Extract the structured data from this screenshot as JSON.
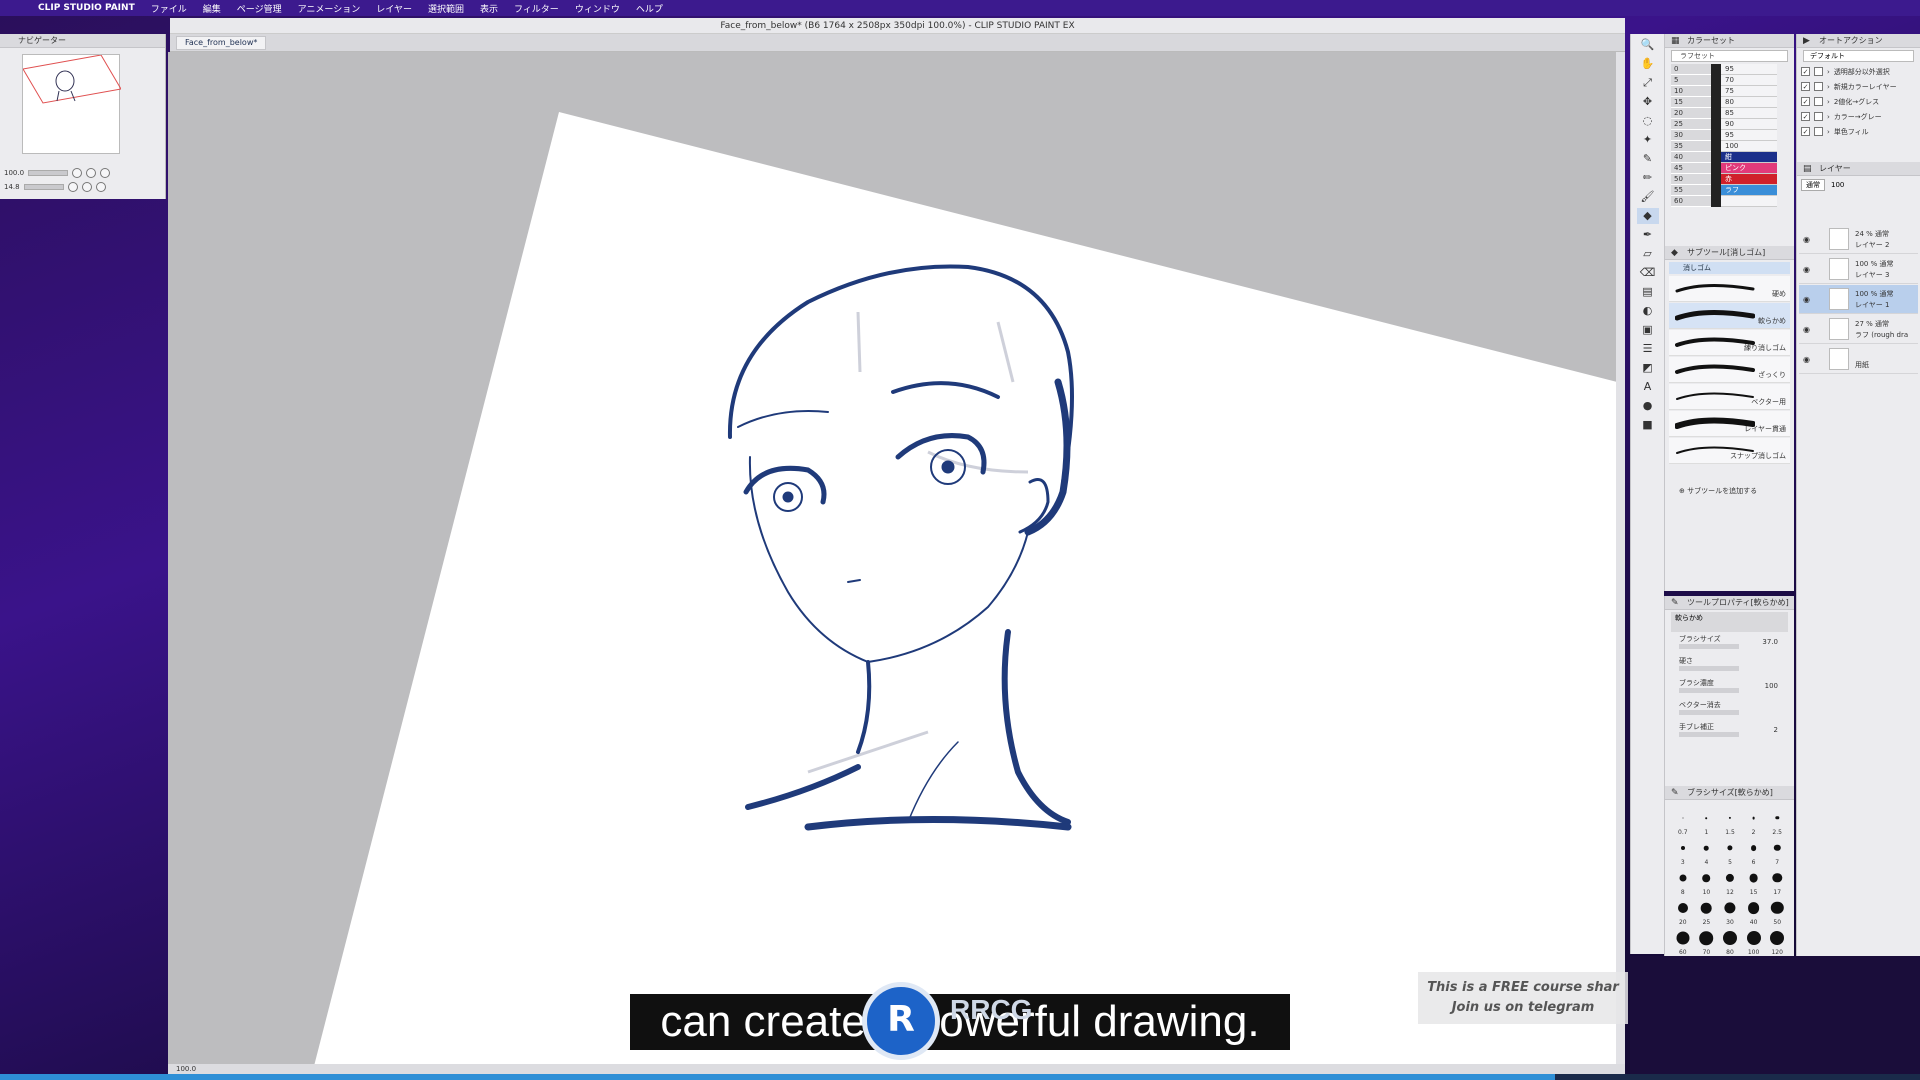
{
  "menubar": {
    "app_name": "CLIP STUDIO PAINT",
    "items": [
      "ファイル",
      "編集",
      "ページ管理",
      "アニメーション",
      "レイヤー",
      "選択範囲",
      "表示",
      "フィルター",
      "ウィンドウ",
      "ヘルプ"
    ]
  },
  "window": {
    "title": "Face_from_below* (B6 1764 x 2508px 350dpi 100.0%)  - CLIP STUDIO PAINT EX",
    "tab_label": "Face_from_below*"
  },
  "navigator": {
    "title": "ナビゲーター",
    "zoom_value": "100.0",
    "rotation_value": "14.8"
  },
  "canvas": {
    "status_zoom": "100.0",
    "progress": 0.81
  },
  "subtitle": {
    "text": "can create a powerful drawing."
  },
  "watermark": {
    "logo_text": "R",
    "brand": "RRCG"
  },
  "promo": {
    "line1": "This is a FREE course shar",
    "line2": "Join us on telegram"
  },
  "tools": [
    "🔍",
    "✋",
    "⤢",
    "✥",
    "◌",
    "✦",
    "✎",
    "✏",
    "🖌",
    "◆",
    "✒",
    "▱",
    "⌫",
    "▤",
    "◐",
    "▣",
    "☰",
    "◩",
    "A",
    "●",
    "■"
  ],
  "color_set": {
    "title": "カラーセット",
    "preset": "ラフセット",
    "rows": [
      {
        "a": "0",
        "c": "95"
      },
      {
        "a": "5",
        "c": "70"
      },
      {
        "a": "10",
        "c": "75"
      },
      {
        "a": "15",
        "c": "80"
      },
      {
        "a": "20",
        "c": "85"
      },
      {
        "a": "25",
        "c": "90"
      },
      {
        "a": "30",
        "c": "95"
      },
      {
        "a": "35",
        "c": "100"
      },
      {
        "a": "40",
        "c": "紺"
      },
      {
        "a": "45",
        "c": "ピンク"
      },
      {
        "a": "50",
        "c": "赤"
      },
      {
        "a": "55",
        "c": "ラフ"
      },
      {
        "a": "60",
        "c": ""
      }
    ],
    "accent_colors": [
      "#1b2f8a",
      "#e23a7a",
      "#d0202a",
      "#3a8ed8"
    ]
  },
  "subtool": {
    "title": "サブツール[消しゴム]",
    "group": "消しゴム",
    "brushes": [
      "硬め",
      "軟らかめ",
      "練り消しゴム",
      "ざっくり",
      "ベクター用",
      "レイヤー貫通",
      "スナップ消しゴム"
    ],
    "add_label": "サブツールを追加する"
  },
  "tool_property": {
    "title": "ツールプロパティ[軟らかめ]",
    "name": "軟らかめ",
    "rows": [
      {
        "label": "ブラシサイズ",
        "value": "37.0"
      },
      {
        "label": "硬さ",
        "value": ""
      },
      {
        "label": "ブラシ濃度",
        "value": "100"
      },
      {
        "label": "ベクター消去",
        "value": ""
      },
      {
        "label": "手ブレ補正",
        "value": "2"
      }
    ]
  },
  "brush_size": {
    "title": "ブラシサイズ[軟らかめ]",
    "sizes": [
      "0.7",
      "1",
      "1.5",
      "2",
      "2.5",
      "3",
      "4",
      "5",
      "6",
      "7",
      "8",
      "10",
      "12",
      "15",
      "17",
      "20",
      "25",
      "30",
      "40",
      "50",
      "60",
      "70",
      "80",
      "100",
      "120"
    ]
  },
  "auto_action": {
    "title": "オートアクション",
    "preset": "デフォルト",
    "items": [
      "透明部分以外選択",
      "新規カラーレイヤー",
      "2値化→グレス",
      "カラー→グレー",
      "単色フィル"
    ]
  },
  "layers": {
    "title": "レイヤー",
    "blend": "通常",
    "opacity": "100",
    "items": [
      {
        "line1": "24 % 通常",
        "line2": "レイヤー 2",
        "selected": false
      },
      {
        "line1": "100 % 通常",
        "line2": "レイヤー 3",
        "selected": false
      },
      {
        "line1": "100 % 通常",
        "line2": "レイヤー 1",
        "selected": true
      },
      {
        "line1": "27 % 通常",
        "line2": "ラフ (rough dra",
        "selected": false
      },
      {
        "line1": "",
        "line2": "用紙",
        "selected": false
      }
    ]
  }
}
